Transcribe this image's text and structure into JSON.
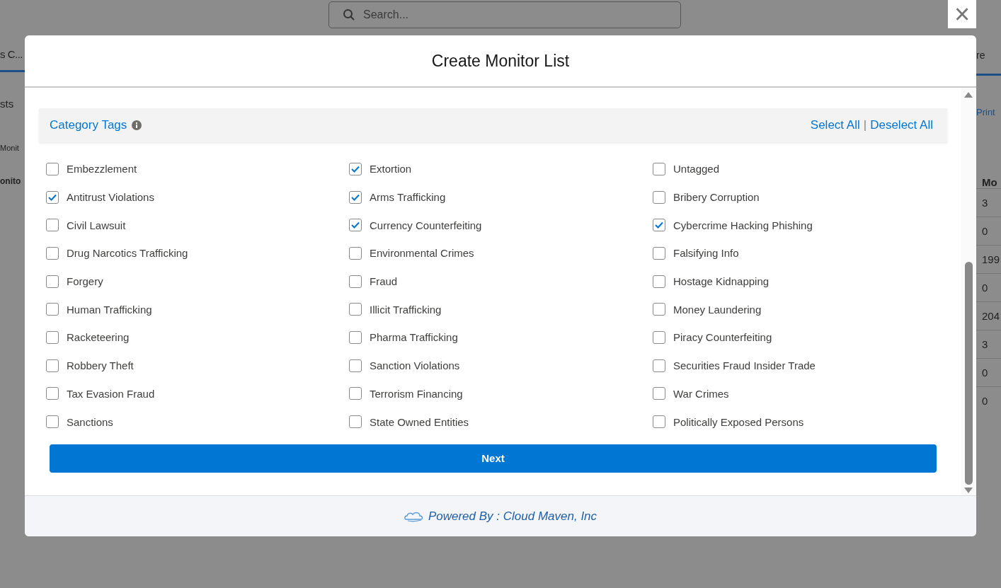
{
  "background": {
    "search": {
      "placeholder": "Search..."
    },
    "left_fragments": [
      "s C...",
      "sts",
      "Monit",
      "onito"
    ],
    "right_fragments": [
      "re",
      "Print",
      "Mo"
    ],
    "right_cells": [
      "3",
      "0",
      "199",
      "0",
      "204",
      "3",
      "0",
      "0"
    ]
  },
  "close_button": {
    "label": "×"
  },
  "modal": {
    "title": "Create Monitor List",
    "section": {
      "title": "Category Tags",
      "select_all": "Select All",
      "separator": "|",
      "deselect_all": "Deselect All"
    },
    "tags": [
      {
        "label": "Embezzlement",
        "checked": false
      },
      {
        "label": "Extortion",
        "checked": true
      },
      {
        "label": "Untagged",
        "checked": false
      },
      {
        "label": "Antitrust Violations",
        "checked": true
      },
      {
        "label": "Arms Trafficking",
        "checked": true
      },
      {
        "label": "Bribery Corruption",
        "checked": false
      },
      {
        "label": "Civil Lawsuit",
        "checked": false
      },
      {
        "label": "Currency Counterfeiting",
        "checked": true
      },
      {
        "label": "Cybercrime Hacking Phishing",
        "checked": true
      },
      {
        "label": "Drug Narcotics Trafficking",
        "checked": false
      },
      {
        "label": "Environmental Crimes",
        "checked": false
      },
      {
        "label": "Falsifying Info",
        "checked": false
      },
      {
        "label": "Forgery",
        "checked": false
      },
      {
        "label": "Fraud",
        "checked": false
      },
      {
        "label": "Hostage Kidnapping",
        "checked": false
      },
      {
        "label": "Human Trafficking",
        "checked": false
      },
      {
        "label": "Illicit Trafficking",
        "checked": false
      },
      {
        "label": "Money Laundering",
        "checked": false
      },
      {
        "label": "Racketeering",
        "checked": false
      },
      {
        "label": "Pharma Trafficking",
        "checked": false
      },
      {
        "label": "Piracy Counterfeiting",
        "checked": false
      },
      {
        "label": "Robbery Theft",
        "checked": false
      },
      {
        "label": "Sanction Violations",
        "checked": false
      },
      {
        "label": "Securities Fraud Insider Trade",
        "checked": false
      },
      {
        "label": "Tax Evasion Fraud",
        "checked": false
      },
      {
        "label": "Terrorism Financing",
        "checked": false
      },
      {
        "label": "War Crimes",
        "checked": false
      },
      {
        "label": "Sanctions",
        "checked": false
      },
      {
        "label": "State Owned Entities",
        "checked": false
      },
      {
        "label": "Politically Exposed Persons",
        "checked": false
      }
    ],
    "next_button": "Next",
    "footer": "Powered By : Cloud Maven, Inc"
  }
}
